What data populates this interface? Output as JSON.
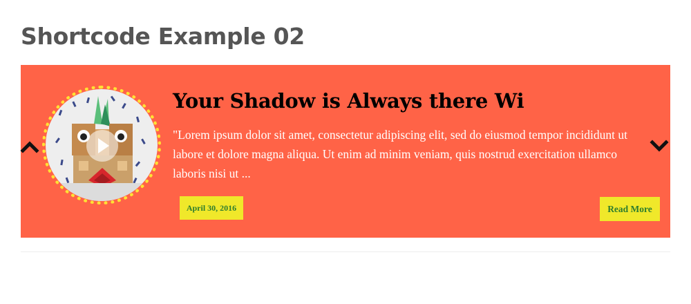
{
  "page": {
    "title": "Shortcode Example 02"
  },
  "slider": {
    "background_color": "#ff6347",
    "accent_color": "#f0e82a",
    "thumbnail": {
      "icon": "play-icon",
      "ring_color": "#ffe234"
    },
    "post": {
      "title": "Your Shadow is Always there Wi",
      "excerpt": "\"Lorem ipsum dolor sit amet, consectetur adipiscing elit, sed do eiusmod tempor incididunt ut labore et dolore magna aliqua. Ut enim ad minim veniam, quis nostrud exercitation ullamco laboris nisi ut ...",
      "date": "April 30, 2016",
      "read_more_label": "Read More"
    },
    "prev_icon": "chevron-up-icon",
    "next_icon": "chevron-down-icon"
  }
}
